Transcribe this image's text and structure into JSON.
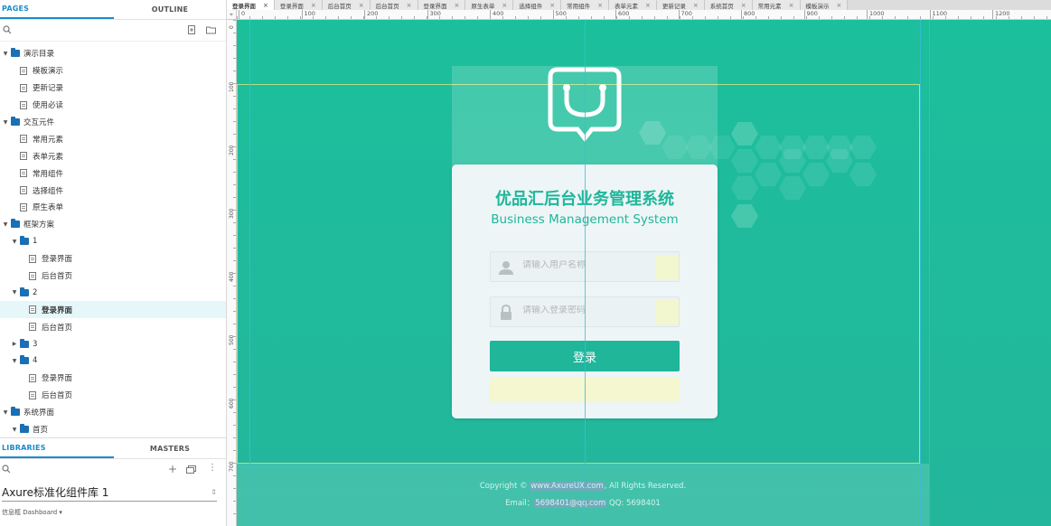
{
  "left_panel": {
    "tabs": [
      "PAGES",
      "OUTLINE"
    ],
    "tree": [
      {
        "type": "folder",
        "label": "演示目录",
        "level": 0,
        "open": true
      },
      {
        "type": "page",
        "label": "模板演示",
        "level": 1
      },
      {
        "type": "page",
        "label": "更新记录",
        "level": 1
      },
      {
        "type": "page",
        "label": "使用必读",
        "level": 1
      },
      {
        "type": "folder",
        "label": "交互元件",
        "level": 0,
        "open": true
      },
      {
        "type": "page",
        "label": "常用元素",
        "level": 1
      },
      {
        "type": "page",
        "label": "表单元素",
        "level": 1
      },
      {
        "type": "page",
        "label": "常用组件",
        "level": 1
      },
      {
        "type": "page",
        "label": "选择组件",
        "level": 1
      },
      {
        "type": "page",
        "label": "原生表单",
        "level": 1
      },
      {
        "type": "folder",
        "label": "框架方案",
        "level": 0,
        "open": true
      },
      {
        "type": "folder",
        "label": "1",
        "level": 1,
        "open": true
      },
      {
        "type": "page",
        "label": "登录界面",
        "level": 2
      },
      {
        "type": "page",
        "label": "后台首页",
        "level": 2
      },
      {
        "type": "folder",
        "label": "2",
        "level": 1,
        "open": true
      },
      {
        "type": "page",
        "label": "登录界面",
        "level": 2,
        "selected": true
      },
      {
        "type": "page",
        "label": "后台首页",
        "level": 2
      },
      {
        "type": "folder",
        "label": "3",
        "level": 1,
        "open": false
      },
      {
        "type": "folder",
        "label": "4",
        "level": 1,
        "open": true
      },
      {
        "type": "page",
        "label": "登录界面",
        "level": 2
      },
      {
        "type": "page",
        "label": "后台首页",
        "level": 2
      },
      {
        "type": "folder",
        "label": "系统界面",
        "level": 0,
        "open": true
      },
      {
        "type": "folder",
        "label": "首页",
        "level": 1,
        "open": true
      }
    ],
    "lib_tabs": [
      "LIBRARIES",
      "MASTERS"
    ],
    "library_name": "Axure标准化组件库 1",
    "library_sub": "信息框 Dashboard ▾"
  },
  "doc_tabs": [
    {
      "label": "登录界面",
      "active": true
    },
    {
      "label": "登录界面"
    },
    {
      "label": "后台首页"
    },
    {
      "label": "后台首页"
    },
    {
      "label": "登录界面"
    },
    {
      "label": "原生表单"
    },
    {
      "label": "选择组件"
    },
    {
      "label": "常用组件"
    },
    {
      "label": "表单元素"
    },
    {
      "label": "更新记录"
    },
    {
      "label": "系统首页"
    },
    {
      "label": "常用元素"
    },
    {
      "label": "模板演示"
    }
  ],
  "ruler_h": [
    "0",
    "100",
    "200",
    "300",
    "400",
    "500",
    "600",
    "700",
    "800",
    "900",
    "1000",
    "1100",
    "1200"
  ],
  "ruler_v": [
    "0",
    "100",
    "200",
    "300",
    "400",
    "500",
    "600",
    "700"
  ],
  "login": {
    "title": "优品汇后台业务管理系统",
    "subtitle": "Business Management System",
    "username_placeholder": "请输入用户名称",
    "password_placeholder": "请输入登录密码",
    "login_label": "登录",
    "footer_line1_pre": "Copyright © ",
    "footer_line1_link": "www.AxureUX.com",
    "footer_line1_post": ", All Rights Reserved.",
    "footer_line2_pre": "Email：",
    "footer_line2_link": "5698401@qq.com",
    "footer_line2_post": "  QQ: 5698401"
  },
  "colors": {
    "primary": "#1fb69a",
    "canvas": "#1dbd9a",
    "accent": "#1a8cc9"
  }
}
